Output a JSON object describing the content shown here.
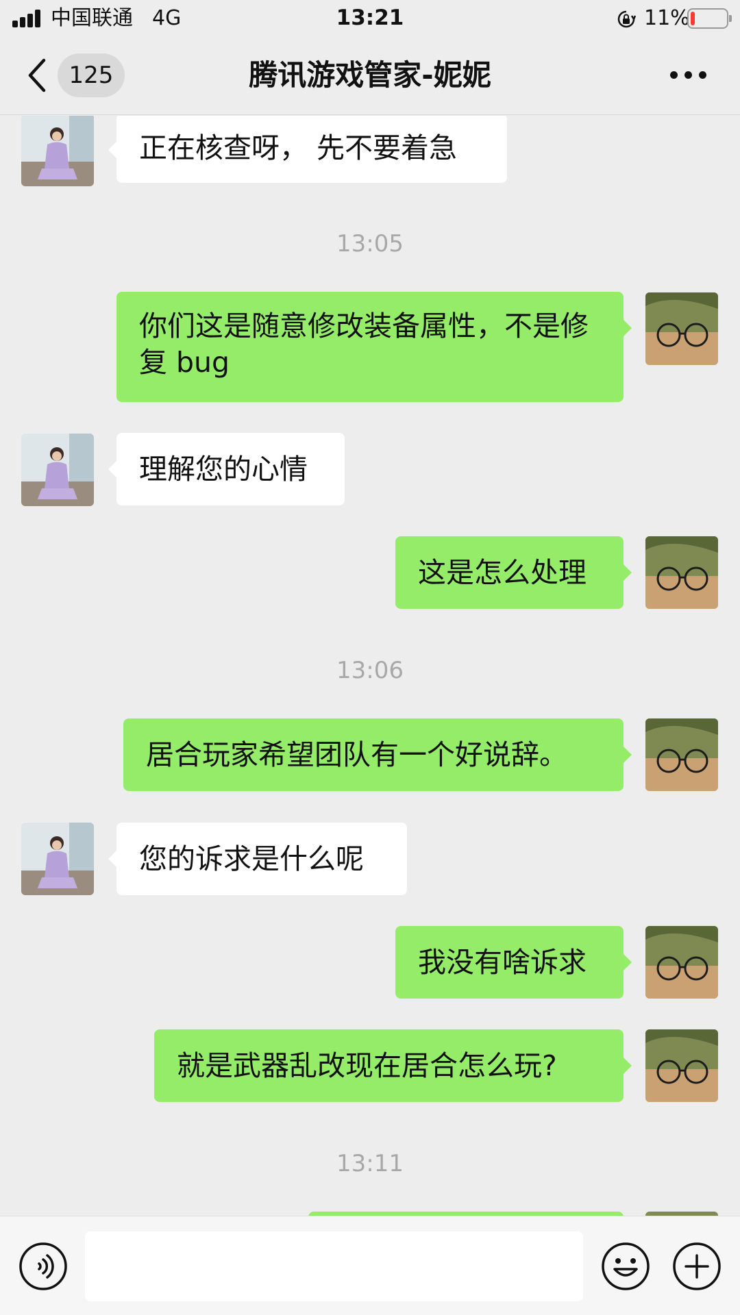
{
  "status_bar": {
    "carrier": "中国联通",
    "network": "4G",
    "time": "13:21",
    "battery_percent": "11%",
    "battery_level": 0.11,
    "battery_color": "#ff3b30"
  },
  "header": {
    "back_icon": "chevron-left-icon",
    "unread_count": "125",
    "title": "腾讯游戏管家-妮妮",
    "more_icon": "more-dots-icon"
  },
  "messages": [
    {
      "type": "incoming",
      "text": "正在核查呀， 先不要着急"
    },
    {
      "type": "time",
      "text": "13:05"
    },
    {
      "type": "outgoing",
      "text": "你们这是随意修改装备属性，不是修复 bug"
    },
    {
      "type": "incoming",
      "text": "理解您的心情"
    },
    {
      "type": "outgoing",
      "text": "这是怎么处理"
    },
    {
      "type": "time",
      "text": "13:06"
    },
    {
      "type": "outgoing",
      "text": "居合玩家希望团队有一个好说辞。"
    },
    {
      "type": "incoming",
      "text": "您的诉求是什么呢"
    },
    {
      "type": "outgoing",
      "text": "我没有啥诉求"
    },
    {
      "type": "outgoing",
      "text": "就是武器乱改现在居合怎么玩?"
    },
    {
      "type": "time",
      "text": "13:11"
    }
  ],
  "input_bar": {
    "voice_icon": "voice-icon",
    "input_value": "",
    "emoji_icon": "emoji-icon",
    "plus_icon": "plus-icon"
  },
  "colors": {
    "background": "#ededed",
    "outgoing_bubble": "#95ec69",
    "incoming_bubble": "#ffffff",
    "timestamp": "#a8a8a8"
  }
}
